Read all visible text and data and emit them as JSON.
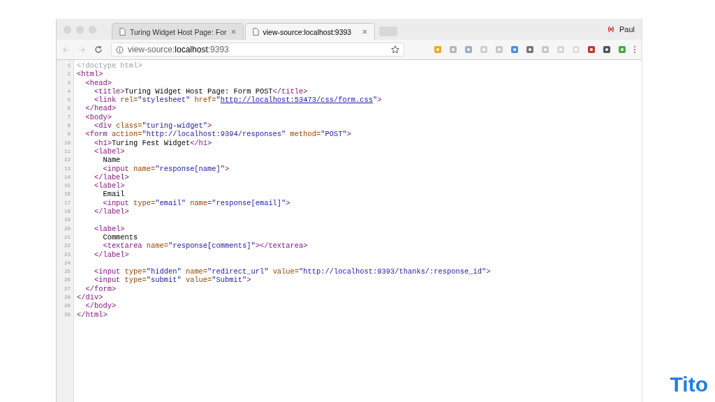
{
  "tabs": [
    {
      "title": "Turing Widget Host Page: For",
      "selected": false
    },
    {
      "title": "view-source:localhost:9393",
      "selected": true
    }
  ],
  "profile": {
    "name": "Paul"
  },
  "address": {
    "scheme": "view-source:",
    "host": "localhost",
    "port": ":9393"
  },
  "source_lines": [
    {
      "number": "1",
      "tokens": [
        {
          "kind": "comment",
          "text": "<!doctype html>"
        }
      ]
    },
    {
      "number": "2",
      "tokens": [
        {
          "kind": "tag",
          "text": "<html>"
        }
      ],
      "children": [
        {
          "number": "3",
          "tokens": [
            {
              "kind": "tag",
              "text": "<head>"
            }
          ],
          "children": [
            {
              "number": "4",
              "tokens": [
                {
                  "kind": "tag",
                  "text": "<title>"
                },
                {
                  "kind": "text",
                  "text": "Turing Widget Host Page: Form POST"
                },
                {
                  "kind": "tag",
                  "text": "</title>"
                }
              ]
            },
            {
              "number": "5",
              "tokens": [
                {
                  "kind": "tag",
                  "text": "<link "
                },
                {
                  "kind": "attr",
                  "text": "rel="
                },
                {
                  "kind": "value",
                  "text": "\"stylesheet\" "
                },
                {
                  "kind": "attr",
                  "text": "href="
                },
                {
                  "kind": "value",
                  "text": "\""
                },
                {
                  "kind": "link",
                  "text": "http://localhost:53473/css/form.css"
                },
                {
                  "kind": "value",
                  "text": "\""
                },
                {
                  "kind": "tag",
                  "text": ">"
                }
              ]
            }
          ]
        },
        {
          "number": "6",
          "tokens": [
            {
              "kind": "tag",
              "text": "</head>"
            }
          ]
        },
        {
          "number": "7",
          "tokens": [
            {
              "kind": "tag",
              "text": "<body>"
            }
          ],
          "children": [
            {
              "number": "8",
              "tokens": [
                {
                  "kind": "tag",
                  "text": "<div "
                },
                {
                  "kind": "attr",
                  "text": "class="
                },
                {
                  "kind": "value",
                  "text": "\"turing-widget\""
                },
                {
                  "kind": "tag",
                  "text": ">"
                }
              ]
            }
          ]
        },
        {
          "number": "9",
          "tokens": [
            {
              "kind": "tag",
              "text": "<form "
            },
            {
              "kind": "attr",
              "text": "action="
            },
            {
              "kind": "value",
              "text": "\"http://localhost:9394/responses\" "
            },
            {
              "kind": "attr",
              "text": "method="
            },
            {
              "kind": "value",
              "text": "\"POST\""
            },
            {
              "kind": "tag",
              "text": ">"
            }
          ],
          "children": [
            {
              "number": "10",
              "tokens": [
                {
                  "kind": "tag",
                  "text": "<h1>"
                },
                {
                  "kind": "text",
                  "text": "Turing Fest Widget"
                },
                {
                  "kind": "tag",
                  "text": "</h1>"
                }
              ]
            },
            {
              "number": "11",
              "tokens": [
                {
                  "kind": "tag",
                  "text": "<label>"
                }
              ],
              "children": [
                {
                  "number": "12",
                  "tokens": [
                    {
                      "kind": "text",
                      "text": "Name"
                    }
                  ]
                },
                {
                  "number": "13",
                  "tokens": [
                    {
                      "kind": "tag",
                      "text": "<input "
                    },
                    {
                      "kind": "attr",
                      "text": "name="
                    },
                    {
                      "kind": "value",
                      "text": "\"response[name]\""
                    },
                    {
                      "kind": "tag",
                      "text": ">"
                    }
                  ]
                }
              ]
            },
            {
              "number": "14",
              "tokens": [
                {
                  "kind": "tag",
                  "text": "</label>"
                }
              ]
            },
            {
              "number": "15",
              "tokens": [
                {
                  "kind": "tag",
                  "text": "<label>"
                }
              ],
              "children": [
                {
                  "number": "16",
                  "tokens": [
                    {
                      "kind": "text",
                      "text": "Email"
                    }
                  ]
                },
                {
                  "number": "17",
                  "tokens": [
                    {
                      "kind": "tag",
                      "text": "<input "
                    },
                    {
                      "kind": "attr",
                      "text": "type="
                    },
                    {
                      "kind": "value",
                      "text": "\"email\" "
                    },
                    {
                      "kind": "attr",
                      "text": "name="
                    },
                    {
                      "kind": "value",
                      "text": "\"response[email]\""
                    },
                    {
                      "kind": "tag",
                      "text": ">"
                    }
                  ]
                }
              ]
            },
            {
              "number": "18",
              "tokens": [
                {
                  "kind": "tag",
                  "text": "</label>"
                }
              ]
            },
            {
              "number": "19"
            },
            {
              "number": "20",
              "tokens": [
                {
                  "kind": "tag",
                  "text": "<label>"
                }
              ],
              "children": [
                {
                  "number": "21",
                  "tokens": [
                    {
                      "kind": "text",
                      "text": "Comments"
                    }
                  ]
                },
                {
                  "number": "22",
                  "tokens": [
                    {
                      "kind": "tag",
                      "text": "<textarea "
                    },
                    {
                      "kind": "attr",
                      "text": "name="
                    },
                    {
                      "kind": "value",
                      "text": "\"response[comments]\""
                    },
                    {
                      "kind": "tag",
                      "text": "></textarea>"
                    }
                  ]
                }
              ]
            },
            {
              "number": "23",
              "tokens": [
                {
                  "kind": "tag",
                  "text": "</label>"
                }
              ]
            },
            {
              "number": "24"
            },
            {
              "number": "25",
              "tokens": [
                {
                  "kind": "tag",
                  "text": "<input "
                },
                {
                  "kind": "attr",
                  "text": "type="
                },
                {
                  "kind": "value",
                  "text": "\"hidden\" "
                },
                {
                  "kind": "attr",
                  "text": "name="
                },
                {
                  "kind": "value",
                  "text": "\"redirect_url\" "
                },
                {
                  "kind": "attr",
                  "text": "value="
                },
                {
                  "kind": "value",
                  "text": "\"http://localhost:9393/thanks/:response_id\""
                },
                {
                  "kind": "tag",
                  "text": ">"
                }
              ]
            },
            {
              "number": "26",
              "tokens": [
                {
                  "kind": "tag",
                  "text": "<input "
                },
                {
                  "kind": "attr",
                  "text": "type="
                },
                {
                  "kind": "value",
                  "text": "\"submit\" "
                },
                {
                  "kind": "attr",
                  "text": "value="
                },
                {
                  "kind": "value",
                  "text": "\"Submit\""
                },
                {
                  "kind": "tag",
                  "text": ">"
                }
              ]
            }
          ]
        },
        {
          "number": "27",
          "tokens": [
            {
              "kind": "tag",
              "text": "</form>"
            }
          ]
        }
      ]
    },
    {
      "number": "28",
      "tokens": [
        {
          "kind": "tag",
          "text": "</div>"
        }
      ],
      "children": [
        {
          "number": "29",
          "tokens": [
            {
              "kind": "tag",
              "text": "</body>"
            }
          ]
        }
      ]
    },
    {
      "number": "30",
      "tokens": [
        {
          "kind": "tag",
          "text": "</html>"
        }
      ]
    }
  ],
  "logo": {
    "text": "Tito"
  }
}
